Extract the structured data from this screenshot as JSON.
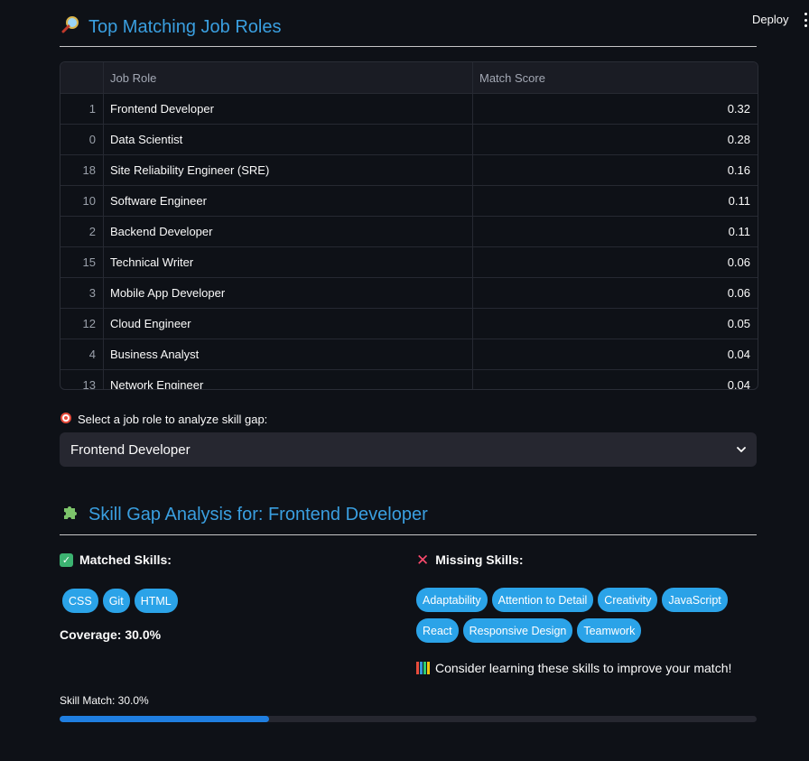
{
  "header": {
    "deploy_label": "Deploy"
  },
  "top_roles": {
    "title": "Top Matching Job Roles",
    "icon": "magnifier-icon",
    "columns": [
      "",
      "Job Role",
      "Match Score"
    ],
    "rows": [
      {
        "index": "1",
        "role": "Frontend Developer",
        "score": "0.32"
      },
      {
        "index": "0",
        "role": "Data Scientist",
        "score": "0.28"
      },
      {
        "index": "18",
        "role": "Site Reliability Engineer (SRE)",
        "score": "0.16"
      },
      {
        "index": "10",
        "role": "Software Engineer",
        "score": "0.11"
      },
      {
        "index": "2",
        "role": "Backend Developer",
        "score": "0.11"
      },
      {
        "index": "15",
        "role": "Technical Writer",
        "score": "0.06"
      },
      {
        "index": "3",
        "role": "Mobile App Developer",
        "score": "0.06"
      },
      {
        "index": "12",
        "role": "Cloud Engineer",
        "score": "0.05"
      },
      {
        "index": "4",
        "role": "Business Analyst",
        "score": "0.04"
      },
      {
        "index": "13",
        "role": "Network Engineer",
        "score": "0.04"
      }
    ]
  },
  "select": {
    "label": "Select a job role to analyze skill gap:",
    "icon": "target-icon",
    "value": "Frontend Developer"
  },
  "skill_gap": {
    "title": "Skill Gap Analysis for: Frontend Developer",
    "icon": "puzzle-icon",
    "matched": {
      "heading": "Matched Skills:",
      "skills": [
        "CSS",
        "Git",
        "HTML"
      ],
      "coverage": "Coverage: 30.0%"
    },
    "missing": {
      "heading": "Missing Skills:",
      "skills": [
        "Adaptability",
        "Attention to Detail",
        "Creativity",
        "JavaScript",
        "React",
        "Responsive Design",
        "Teamwork"
      ],
      "advice": "Consider learning these skills to improve your match!"
    },
    "progress": {
      "label": "Skill Match: 30.0%",
      "value": 0.3
    }
  },
  "colors": {
    "accent": "#3a9fe0",
    "tag": "#2ba3e8",
    "progress": "#1f7ee0",
    "background": "#0e1117"
  }
}
